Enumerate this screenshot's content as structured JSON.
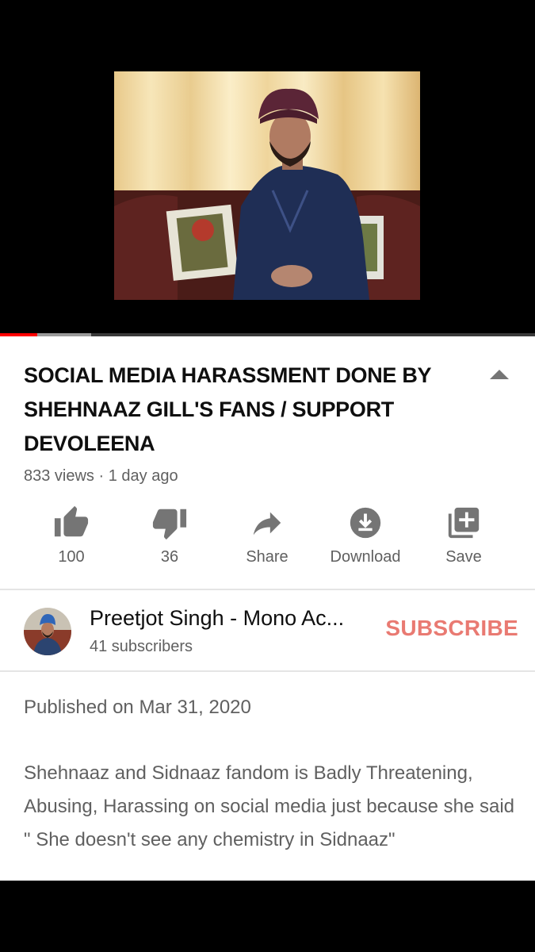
{
  "video": {
    "progress_played": 0.07,
    "progress_buffered": 0.17
  },
  "title": "SOCIAL MEDIA HARASSMENT DONE BY SHEHNAAZ GILL'S FANS / SUPPORT DEVOLEENA",
  "views_line": "833 views · 1 day ago",
  "actions": [
    {
      "icon": "thumbs-up-icon",
      "label": "100"
    },
    {
      "icon": "thumbs-down-icon",
      "label": "36"
    },
    {
      "icon": "share-icon",
      "label": "Share"
    },
    {
      "icon": "download-icon",
      "label": "Download"
    },
    {
      "icon": "save-playlist-icon",
      "label": "Save"
    }
  ],
  "channel": {
    "name": "Preetjot Singh - Mono Ac...",
    "subscribers": "41 subscribers",
    "subscribe_label": "SUBSCRIBE"
  },
  "description": {
    "published": "Published on Mar 31, 2020",
    "text": "Shehnaaz and Sidnaaz fandom is Badly Threatening, Abusing, Harassing on social media just because she said \" She doesn't see any chemistry in Sidnaaz\""
  },
  "colors": {
    "subscribe": "#e97a72",
    "progress_played": "#ff0000",
    "icon_gray": "#757575"
  }
}
